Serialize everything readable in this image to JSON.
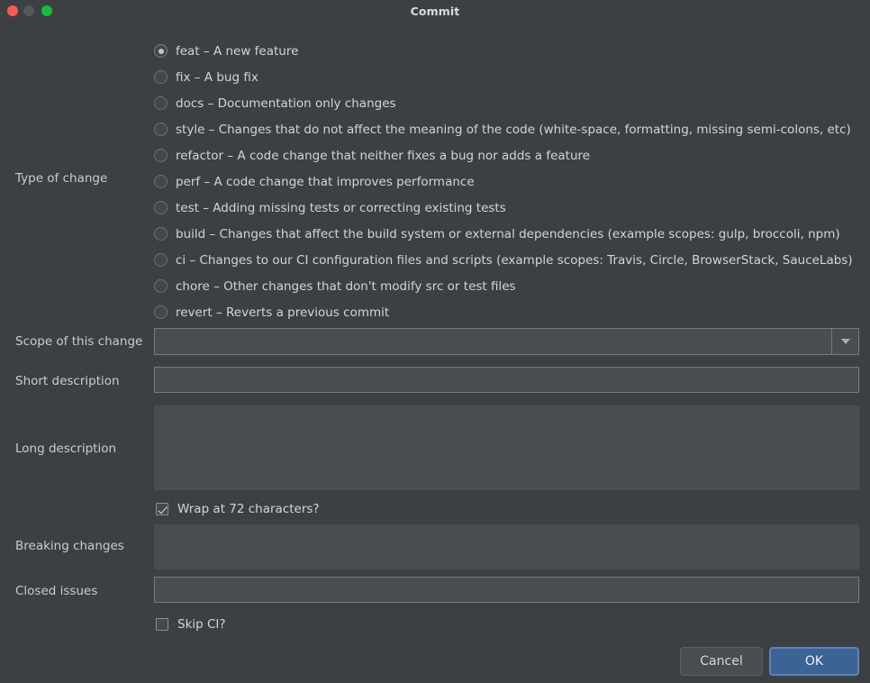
{
  "window": {
    "title": "Commit",
    "traffic_lights": [
      {
        "name": "close",
        "color": "#fa5c53"
      },
      {
        "name": "minimize",
        "color": "#55585b"
      },
      {
        "name": "maximize",
        "color": "#13bf38"
      }
    ]
  },
  "form": {
    "type_of_change": {
      "label": "Type of change",
      "selected_index": 0,
      "options": [
        "feat – A new feature",
        "fix – A bug fix",
        "docs – Documentation only changes",
        "style – Changes that do not affect the meaning of the code (white-space, formatting, missing semi-colons, etc)",
        "refactor – A code change that neither fixes a bug nor adds a feature",
        "perf – A code change that improves performance",
        "test – Adding missing tests or correcting existing tests",
        "build – Changes that affect the build system or external dependencies (example scopes: gulp, broccoli, npm)",
        "ci – Changes to our CI configuration files and scripts (example scopes: Travis, Circle, BrowserStack, SauceLabs)",
        "chore – Other changes that don't modify src or test files",
        "revert – Reverts a previous commit"
      ]
    },
    "scope": {
      "label": "Scope of this change",
      "value": "",
      "placeholder": "",
      "dropdown_icon": "chevron-down-icon"
    },
    "short_description": {
      "label": "Short description",
      "value": "",
      "placeholder": ""
    },
    "long_description": {
      "label": "Long description",
      "value": "",
      "placeholder": ""
    },
    "wrap": {
      "label": "Wrap at 72 characters?",
      "checked": true
    },
    "breaking_changes": {
      "label": "Breaking changes",
      "value": "",
      "placeholder": ""
    },
    "closed_issues": {
      "label": "Closed issues",
      "value": "",
      "placeholder": ""
    },
    "skip_ci": {
      "label": "Skip CI?",
      "checked": false
    }
  },
  "footer": {
    "cancel_label": "Cancel",
    "ok_label": "OK",
    "ok_accent": "#3b6394"
  }
}
